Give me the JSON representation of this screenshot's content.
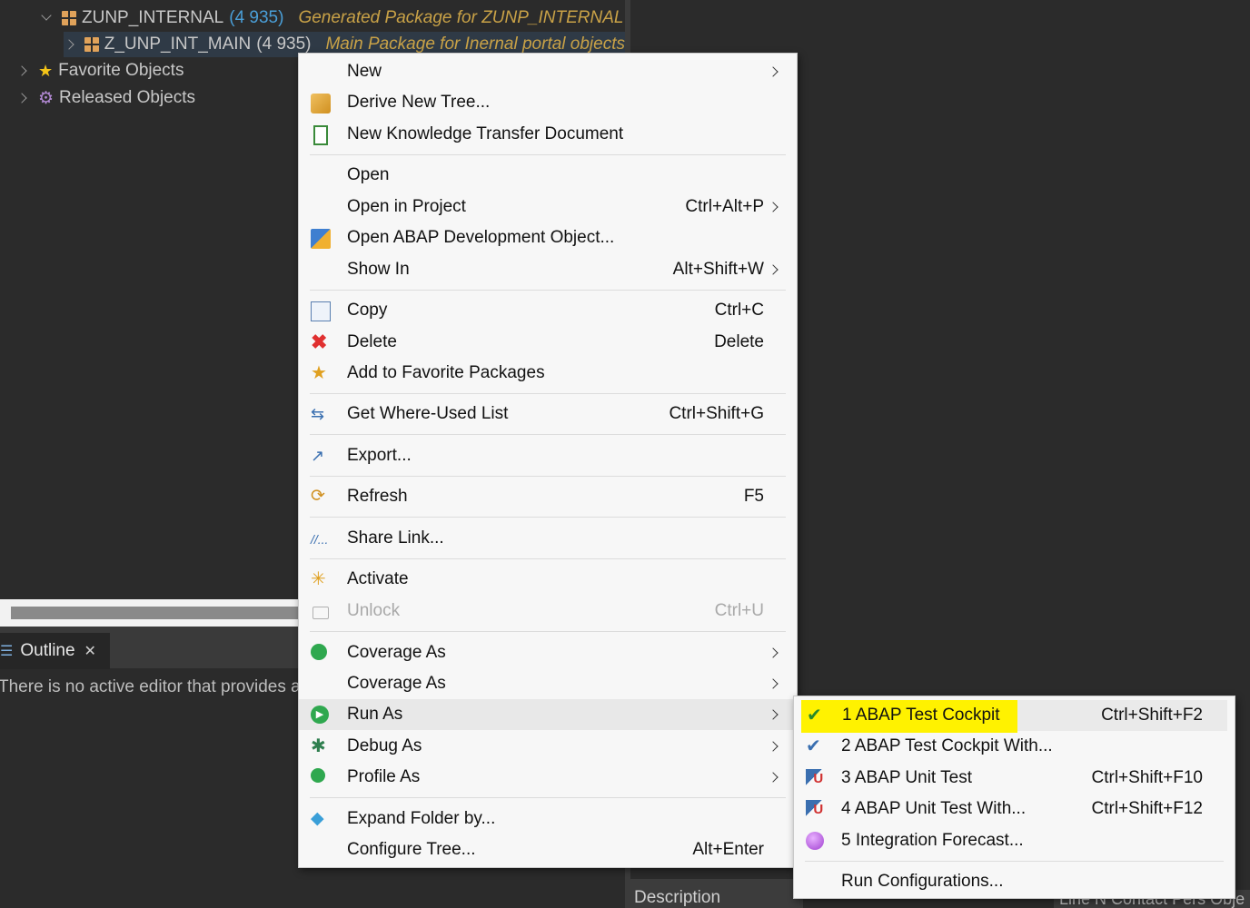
{
  "tree": {
    "items": [
      {
        "name": "ZUNP_INTERNAL",
        "count": "(4 935)",
        "desc": "Generated Package for ZUNP_INTERNAL"
      },
      {
        "name": "Z_UNP_INT_MAIN",
        "count": "(4 935)",
        "desc": "Main Package for Inernal portal objects"
      },
      {
        "name": "Favorite Objects"
      },
      {
        "name": "Released Objects"
      }
    ]
  },
  "outline": {
    "tab_label": "Outline",
    "message": "There is no active editor that provides a"
  },
  "bottom": {
    "description_label": "Description",
    "columns_text": "Line N Contact Pers Obje"
  },
  "context_menu": {
    "items": [
      {
        "label": "New",
        "shortcut": ""
      },
      {
        "label": "Derive New Tree...",
        "shortcut": ""
      },
      {
        "label": "New Knowledge Transfer Document",
        "shortcut": ""
      },
      {
        "label": "Open",
        "shortcut": ""
      },
      {
        "label": "Open in Project",
        "shortcut": "Ctrl+Alt+P"
      },
      {
        "label": "Open ABAP Development Object...",
        "shortcut": ""
      },
      {
        "label": "Show In",
        "shortcut": "Alt+Shift+W"
      },
      {
        "label": "Copy",
        "shortcut": "Ctrl+C"
      },
      {
        "label": "Delete",
        "shortcut": "Delete"
      },
      {
        "label": "Add to Favorite Packages",
        "shortcut": ""
      },
      {
        "label": "Get Where-Used List",
        "shortcut": "Ctrl+Shift+G"
      },
      {
        "label": "Export...",
        "shortcut": ""
      },
      {
        "label": "Refresh",
        "shortcut": "F5"
      },
      {
        "label": "Share Link...",
        "shortcut": ""
      },
      {
        "label": "Activate",
        "shortcut": ""
      },
      {
        "label": "Unlock",
        "shortcut": "Ctrl+U"
      },
      {
        "label": "Coverage As",
        "shortcut": ""
      },
      {
        "label": "Coverage As",
        "shortcut": ""
      },
      {
        "label": "Run As",
        "shortcut": ""
      },
      {
        "label": "Debug As",
        "shortcut": ""
      },
      {
        "label": "Profile As",
        "shortcut": ""
      },
      {
        "label": "Expand Folder by...",
        "shortcut": ""
      },
      {
        "label": "Configure Tree...",
        "shortcut": "Alt+Enter"
      }
    ]
  },
  "run_as_menu": {
    "items": [
      {
        "label": "1 ABAP Test Cockpit",
        "shortcut": "Ctrl+Shift+F2"
      },
      {
        "label": "2 ABAP Test Cockpit With...",
        "shortcut": ""
      },
      {
        "label": "3 ABAP Unit Test",
        "shortcut": "Ctrl+Shift+F10"
      },
      {
        "label": "4 ABAP Unit Test With...",
        "shortcut": "Ctrl+Shift+F12"
      },
      {
        "label": "5 Integration Forecast...",
        "shortcut": ""
      },
      {
        "label": "Run Configurations...",
        "shortcut": ""
      }
    ]
  },
  "colors": {
    "highlight": "#fff200",
    "count": "#4a9fd8",
    "description": "#c9a247"
  }
}
